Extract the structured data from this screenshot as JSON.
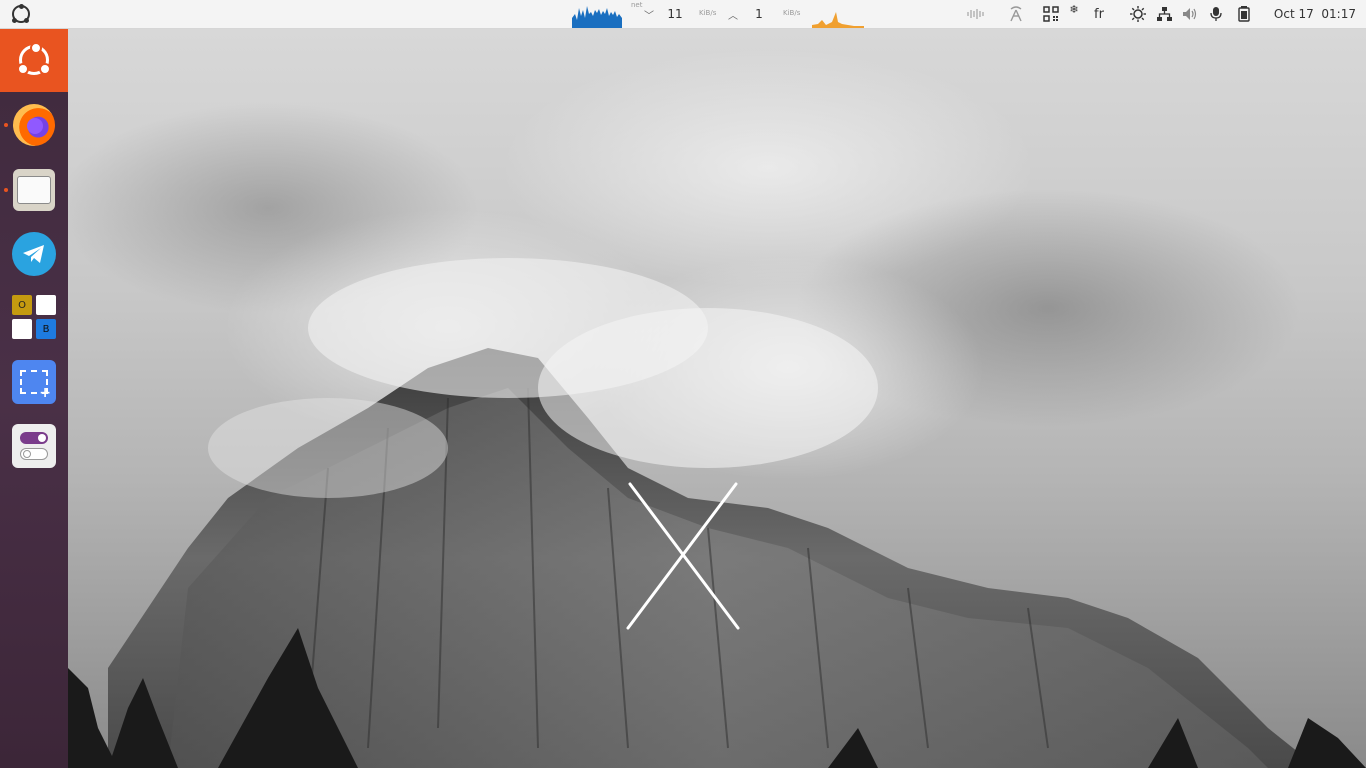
{
  "topbar": {
    "activities_icon": "ubuntu-logo-icon",
    "net_label": "net",
    "download_value": "11",
    "download_unit": "KiB/s",
    "upload_value": "1",
    "upload_unit": "KiB/s",
    "download_arrow": "﹀",
    "upload_arrow": "︿",
    "language": "fr",
    "date": "Oct 17",
    "time": "01:17",
    "status_icons": [
      "audio-wave-icon",
      "antenna-icon",
      "qr-code-icon",
      "snowflake-icon",
      "brightness-icon",
      "network-icon",
      "volume-icon",
      "microphone-icon",
      "battery-icon"
    ]
  },
  "dock": {
    "apps": [
      {
        "name": "Firefox",
        "icon": "firefox-icon",
        "running": true
      },
      {
        "name": "Files",
        "icon": "files-icon",
        "running": true
      },
      {
        "name": "Telegram",
        "icon": "telegram-icon",
        "running": false
      },
      {
        "name": "Office grid",
        "icon": "office-grid-icon",
        "running": false,
        "letters": [
          "O",
          "B"
        ]
      },
      {
        "name": "Screenshot",
        "icon": "screenshot-icon",
        "running": false
      },
      {
        "name": "Tweaks",
        "icon": "toggle-icon",
        "running": false
      }
    ]
  },
  "colors": {
    "ubuntu_orange": "#e95420",
    "dock_bg": "#4a3047",
    "graph_blue": "#1a6fc0",
    "graph_orange": "#f0a030"
  }
}
